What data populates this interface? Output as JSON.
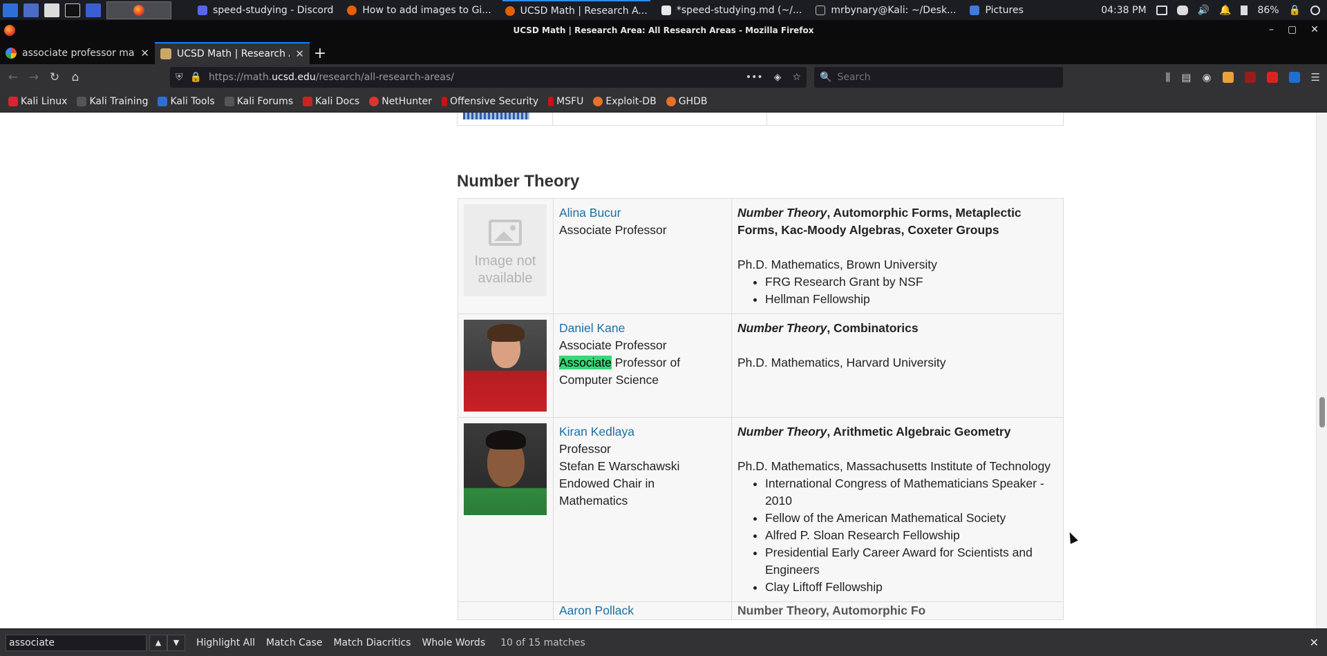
{
  "taskbar": {
    "windows": [
      {
        "label": "speed-studying - Discord",
        "active": false
      },
      {
        "label": "How to add images to Gi...",
        "active": false
      },
      {
        "label": "UCSD Math | Research A...",
        "active": true
      },
      {
        "label": "*speed-studying.md (~/...",
        "active": false
      },
      {
        "label": "mrbynary@Kali: ~/Desk...",
        "active": false
      },
      {
        "label": "Pictures",
        "active": false
      }
    ],
    "clock": "04:38 PM",
    "battery": "86%"
  },
  "window": {
    "title": "UCSD Math | Research Area: All Research Areas - Mozilla Firefox"
  },
  "tabs": [
    {
      "label": "associate professor math",
      "selected": false
    },
    {
      "label": "UCSD Math | Research A",
      "selected": true
    }
  ],
  "url": {
    "pre": "https://math.",
    "host": "ucsd.edu",
    "post": "/research/all-research-areas/"
  },
  "search": {
    "placeholder": "Search"
  },
  "bookmarks": [
    "Kali Linux",
    "Kali Training",
    "Kali Tools",
    "Kali Forums",
    "Kali Docs",
    "NetHunter",
    "Offensive Security",
    "MSFU",
    "Exploit-DB",
    "GHDB"
  ],
  "page": {
    "section_title": "Number Theory",
    "people": [
      {
        "name": "Alina Bucur",
        "titles": [
          "Associate Professor"
        ],
        "photo_text": [
          "Image not",
          "available"
        ],
        "topic_lead": "Number Theory",
        "topic_rest": ", Automorphic Forms, Metaplectic Forms, Kac-Moody Algebras, Coxeter Groups",
        "degree": "Ph.D. Mathematics, Brown University",
        "awards": [
          "FRG Research Grant by NSF",
          "Hellman Fellowship"
        ]
      },
      {
        "name": "Daniel Kane",
        "titles": [
          "Associate Professor"
        ],
        "highlighted_word": "Associate",
        "title_rest": " Professor of Computer Science",
        "topic_lead": "Number Theory",
        "topic_rest": ", Combinatorics",
        "degree": "Ph.D. Mathematics, Harvard University",
        "awards": []
      },
      {
        "name": "Kiran Kedlaya",
        "titles": [
          "Professor",
          "Stefan E Warschawski Endowed Chair in Mathematics"
        ],
        "topic_lead": "Number Theory",
        "topic_rest": ", Arithmetic Algebraic Geometry",
        "degree": "Ph.D. Mathematics, Massachusetts Institute of Technology",
        "awards": [
          "International Congress of Mathematicians Speaker - 2010",
          "Fellow of the American Mathematical Society",
          "Alfred P. Sloan Research Fellowship",
          "Presidential Early Career Award for Scientists and Engineers",
          "Clay Liftoff Fellowship"
        ]
      }
    ],
    "cut_row": {
      "name": "Aaron Pollack",
      "topic": "Number Theory, Automorphic Fo"
    }
  },
  "findbar": {
    "query": "associate",
    "highlight_all": "Highlight All",
    "match_case": "Match Case",
    "match_diacritics": "Match Diacritics",
    "whole_words": "Whole Words",
    "count": "10 of 15 matches"
  },
  "colors": {
    "link": "#1d6ea3",
    "highlight": "#38d878",
    "tab_accent": "#0a84ff"
  }
}
